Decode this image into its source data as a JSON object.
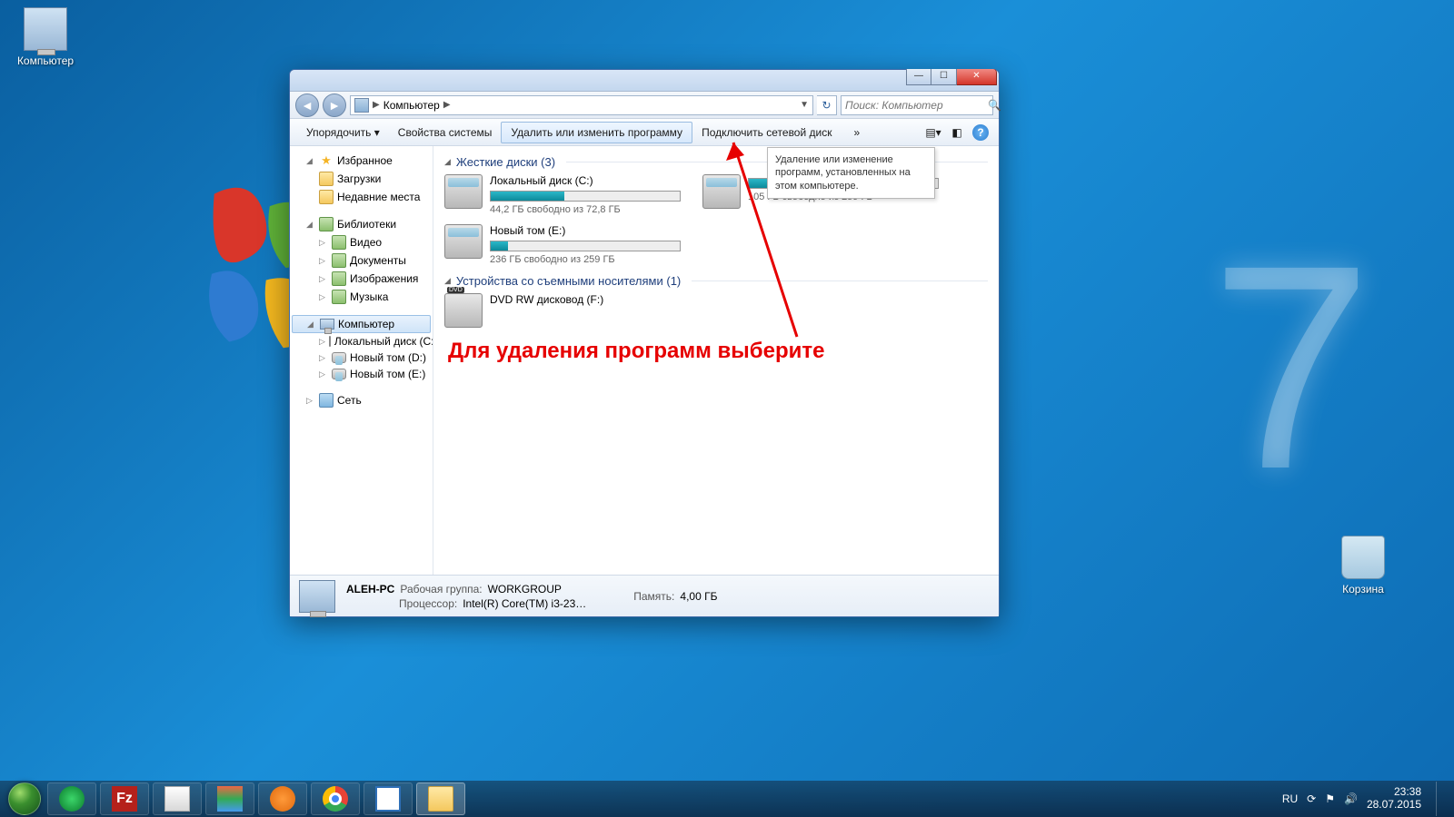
{
  "desktop": {
    "computer": "Компьютер",
    "recycle": "Корзина"
  },
  "window": {
    "breadcrumb": "Компьютер",
    "search_placeholder": "Поиск: Компьютер",
    "toolbar": {
      "organize": "Упорядочить",
      "properties": "Свойства системы",
      "uninstall": "Удалить или изменить программу",
      "mapdrive": "Подключить сетевой диск",
      "overflow": "»"
    },
    "tooltip": "Удаление или изменение программ, установленных на этом компьютере.",
    "sidebar": {
      "favorites": "Избранное",
      "downloads": "Загрузки",
      "recent": "Недавние места",
      "libraries": "Библиотеки",
      "video": "Видео",
      "documents": "Документы",
      "pictures": "Изображения",
      "music": "Музыка",
      "computer": "Компьютер",
      "localc": "Локальный диск (C:)",
      "vold": "Новый том (D:)",
      "vole": "Новый том (E:)",
      "network": "Сеть"
    },
    "groups": {
      "hdd": "Жесткие диски (3)",
      "removable": "Устройства со съемными носителями (1)"
    },
    "drives": {
      "c": {
        "name": "Локальный диск (C:)",
        "free": "44,2 ГБ свободно из 72,8 ГБ",
        "fill_pct": 39
      },
      "d": {
        "name": "",
        "free": "105 ГБ свободно из 259 ГБ",
        "fill_pct": 59
      },
      "e": {
        "name": "Новый том (E:)",
        "free": "236 ГБ свободно из 259 ГБ",
        "fill_pct": 9
      },
      "dvd": {
        "name": "DVD RW дисковод (F:)"
      }
    },
    "details": {
      "pcname": "ALEH-PC",
      "workgroup_label": "Рабочая группа:",
      "workgroup": "WORKGROUP",
      "mem_label": "Память:",
      "mem": "4,00 ГБ",
      "cpu_label": "Процессор:",
      "cpu": "Intel(R) Core(TM) i3-23…"
    }
  },
  "annotation": "Для удаления программ выберите",
  "taskbar": {
    "lang": "RU",
    "time": "23:38",
    "date": "28.07.2015"
  }
}
